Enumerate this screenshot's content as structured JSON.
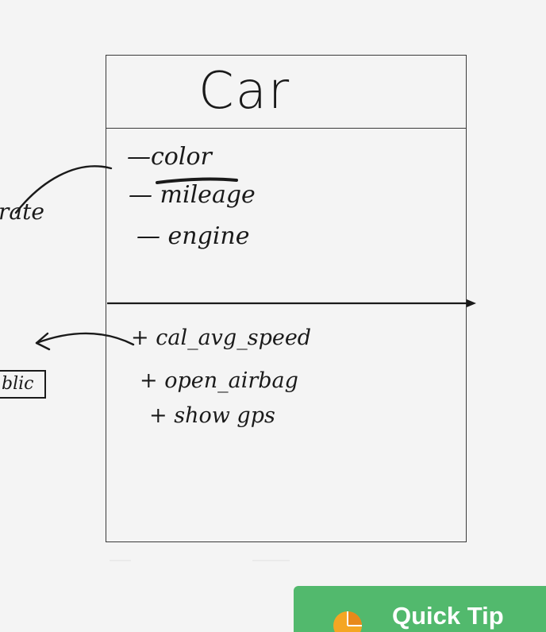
{
  "diagram": {
    "class_name": "Car",
    "attributes": [
      {
        "prefix": "—",
        "name": "color"
      },
      {
        "prefix": "—",
        "name": "mileage"
      },
      {
        "prefix": "—",
        "name": "engine"
      }
    ],
    "methods": [
      {
        "prefix": "+",
        "name": "cal_avg_speed"
      },
      {
        "prefix": "+",
        "name": "open_airbag"
      },
      {
        "prefix": "+",
        "name": "show gps"
      }
    ],
    "annotations": {
      "private_label": "rate",
      "public_label": "blic"
    }
  },
  "quick_tip": {
    "label": "Quick Tip",
    "icon": "tip-pie-icon",
    "color": "#52b96d"
  },
  "colors": {
    "ink": "#1a1a1a",
    "box_stroke": "#3a3a3a",
    "background": "#f4f4f4",
    "tip_icon": "#f5a623"
  }
}
